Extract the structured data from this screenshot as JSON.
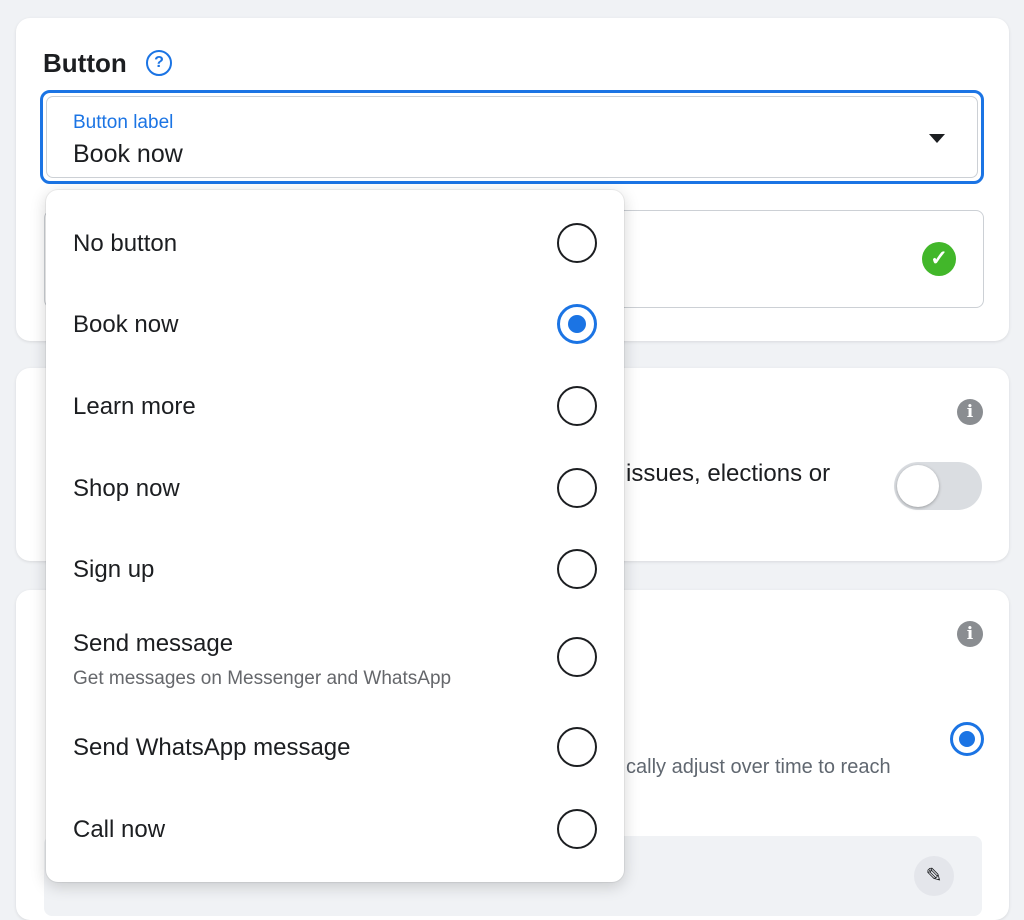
{
  "button_section": {
    "title": "Button",
    "help_icon": "question-icon",
    "select": {
      "label": "Button label",
      "value": "Book now"
    }
  },
  "special_section": {
    "partial_text": "issues, elections or"
  },
  "delivery_section": {
    "partial_text": "cally adjust over time to reach"
  },
  "dropdown": {
    "options": [
      {
        "label": "No button",
        "sub": "",
        "checked": false
      },
      {
        "label": "Book now",
        "sub": "",
        "checked": true
      },
      {
        "label": "Learn more",
        "sub": "",
        "checked": false
      },
      {
        "label": "Shop now",
        "sub": "",
        "checked": false
      },
      {
        "label": "Sign up",
        "sub": "",
        "checked": false
      },
      {
        "label": "Send message",
        "sub": "Get messages on Messenger and WhatsApp",
        "checked": false
      },
      {
        "label": "Send WhatsApp message",
        "sub": "",
        "checked": false
      },
      {
        "label": "Call now",
        "sub": "",
        "checked": false
      }
    ]
  },
  "colors": {
    "accent": "#1b74e4",
    "success": "#42b72a"
  }
}
